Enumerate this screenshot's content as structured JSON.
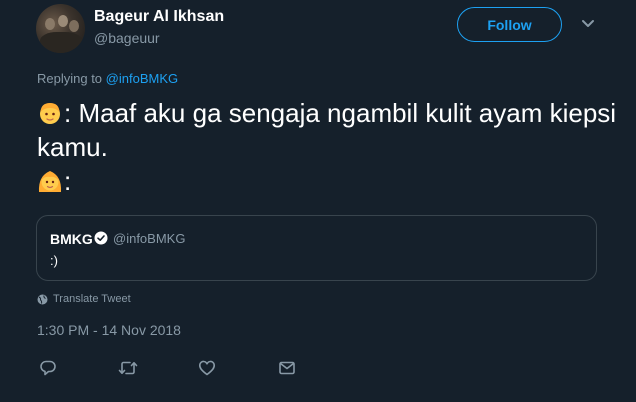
{
  "author": {
    "display_name": "Bageur Al Ikhsan",
    "handle": "@bageuur"
  },
  "follow_label": "Follow",
  "replying": {
    "prefix": "Replying to",
    "target": "@infoBMKG"
  },
  "tweet": {
    "line1_emoji": "man-emoji",
    "line1": ": Maaf aku ga sengaja ngambil kulit ayam kiepsi kamu.",
    "line2_emoji": "woman-emoji",
    "line2": ":"
  },
  "quote": {
    "name": "BMKG",
    "handle": "@infoBMKG",
    "text": ":)"
  },
  "translate_label": "Translate Tweet",
  "timestamp": "1:30 PM - 14 Nov 2018",
  "icons": {
    "reply": "reply-icon",
    "retweet": "retweet-icon",
    "like": "heart-icon",
    "dm": "message-icon"
  },
  "colors": {
    "background": "#15202b",
    "accent": "#1da1f2",
    "secondary_text": "#8899a6",
    "border": "#38444d"
  }
}
